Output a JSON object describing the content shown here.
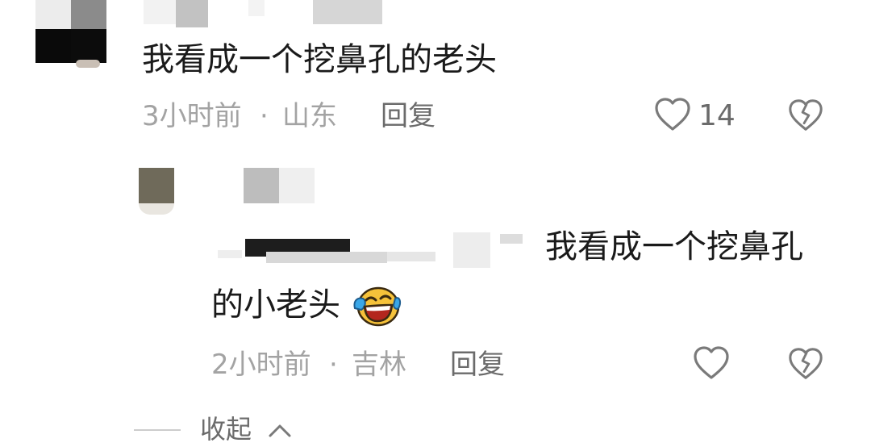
{
  "comments": [
    {
      "text": "我看成一个挖鼻孔的老头",
      "time": "3小时前",
      "separator": "·",
      "location": "山东",
      "reply_label": "回复",
      "like_count": "14",
      "like_icon": "heart-outline-icon",
      "dislike_icon": "broken-heart-icon"
    },
    {
      "text_line1": "我看成一个挖鼻孔",
      "text_line2": "的小老头",
      "emoji": "laughing-crying-emoji",
      "time": "2小时前",
      "separator": "·",
      "location": "吉林",
      "reply_label": "回复",
      "like_icon": "heart-outline-icon",
      "dislike_icon": "broken-heart-icon"
    }
  ],
  "collapse": {
    "label": "收起",
    "icon": "chevron-up-icon"
  },
  "colors": {
    "text": "#1a1a1a",
    "meta": "#a3a3a3",
    "secondary": "#6b6b6b",
    "icon": "#7a7a7a"
  }
}
